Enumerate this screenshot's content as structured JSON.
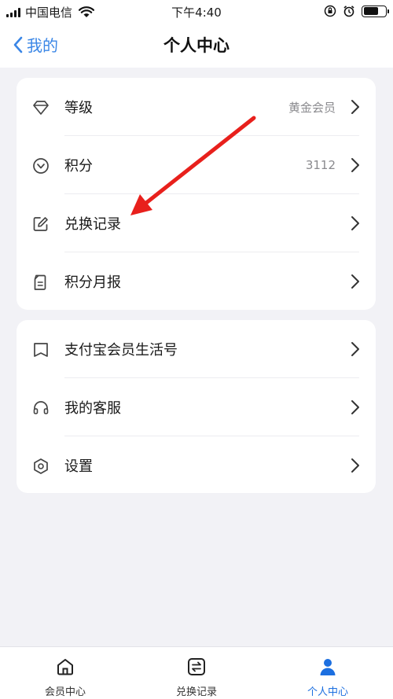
{
  "status_bar": {
    "carrier": "中国电信",
    "time": "下午4:40",
    "battery_level": 0.7
  },
  "nav": {
    "back_label": "我的",
    "title": "个人中心"
  },
  "card1": {
    "items": [
      {
        "label": "等级",
        "value": "黄金会员",
        "icon": "diamond-icon"
      },
      {
        "label": "积分",
        "value": "3112",
        "icon": "coin-icon"
      },
      {
        "label": "兑换记录",
        "value": "",
        "icon": "edit-icon"
      },
      {
        "label": "积分月报",
        "value": "",
        "icon": "report-icon"
      }
    ]
  },
  "card2": {
    "items": [
      {
        "label": "支付宝会员生活号",
        "icon": "bookmark-icon"
      },
      {
        "label": "我的客服",
        "icon": "headset-icon"
      },
      {
        "label": "设置",
        "icon": "settings-icon"
      }
    ]
  },
  "tab_bar": {
    "tabs": [
      {
        "label": "会员中心",
        "icon": "home-icon"
      },
      {
        "label": "兑换记录",
        "icon": "exchange-icon"
      },
      {
        "label": "个人中心",
        "icon": "person-icon",
        "active": true
      }
    ]
  },
  "colors": {
    "accent": "#3a86e6",
    "annotation_arrow": "#e8201c",
    "active_tab": "#1c6fe0"
  }
}
